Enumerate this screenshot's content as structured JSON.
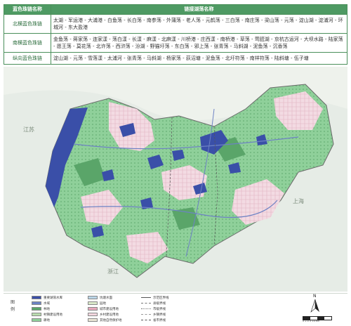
{
  "table": {
    "header_col1": "蓝色珠链名称",
    "header_col2": "链接湖荡名称",
    "rows": [
      {
        "name": "北横蓝色珠链",
        "lakes": "太湖 - 军运港 - 大浦港 - 白鱼荡 - 长白荡 - 南参荡 - 外蒲荡 - 老人荡 - 元鹤荡 - 三白荡 - 南庄荡 - 梁山荡 - 元荡 - 淀山湖 - 淀浦河 - 环城河 - 东大盈港"
      },
      {
        "name": "南横蓝色珠链",
        "lakes": "金鱼荡 - 蒋家荡 - 连家漾 - 荡白漾 - 长漾 - 麻漾 - 北麻漾 - 川桥港 - 庄西漾 - 南桥港 - 草荡 - 莺脰湖 - 京杭古运河 - 大坝水路 - 陆家荡 - 愿王荡 - 莫花荡 - 北许荡 - 西浒荡 - 汾湖 - 野猫圩荡 - 东白荡 - 邪上荡 - 张青荡 - 马斜湖 - 泥鱼荡 - 沉香荡"
      },
      {
        "name": "纵向蓝色珠链",
        "lakes": "淀山湖 - 元荡 - 雪落漾 - 太浦河 - 张青荡 - 马斜湖 - 杨家荡 - 荻沼塘 - 泥鱼荡 - 北圩符荡 - 南祥符荡 - 陆斜塘 - 伍子塘"
      }
    ]
  },
  "map": {
    "labels": {
      "jiangsu": "江苏",
      "shanghai": "上海",
      "zhejiang": "浙江"
    }
  },
  "legend": {
    "title": "图例",
    "items": [
      {
        "label": "重要湖荡水库",
        "color": "#3a4fa8",
        "kind": "fill"
      },
      {
        "label": "水域",
        "color": "#6d82c4",
        "kind": "fill"
      },
      {
        "label": "林地",
        "color": "#5aa569",
        "kind": "fill"
      },
      {
        "label": "村镇建设用地",
        "color": "#b9dcae",
        "kind": "fill"
      },
      {
        "label": "耕地",
        "color": "#8fd09a",
        "kind": "fill"
      },
      {
        "label": "坑塘水面",
        "color": "#b9d4e6",
        "kind": "fill"
      },
      {
        "label": "园地",
        "color": "#d8e8c8",
        "kind": "fill"
      },
      {
        "label": "城市建设用地",
        "color": "#e6a9bc",
        "kind": "fill"
      },
      {
        "label": "乡村建设用地",
        "color": "#f2d6de",
        "kind": "fill"
      },
      {
        "label": "其他自然保护地",
        "color": "#e9e4d4",
        "kind": "fill"
      },
      {
        "label": "示范区界线",
        "color": "#555555",
        "kind": "line"
      },
      {
        "label": "县级界线",
        "color": "#777777",
        "kind": "line"
      },
      {
        "label": "市级界线",
        "color": "#777777",
        "kind": "line"
      },
      {
        "label": "乡镇界线",
        "color": "#999999",
        "kind": "line"
      },
      {
        "label": "省市界线",
        "color": "#555555",
        "kind": "line"
      }
    ],
    "north": "N",
    "scale": "0  2.5  5      10 km"
  }
}
